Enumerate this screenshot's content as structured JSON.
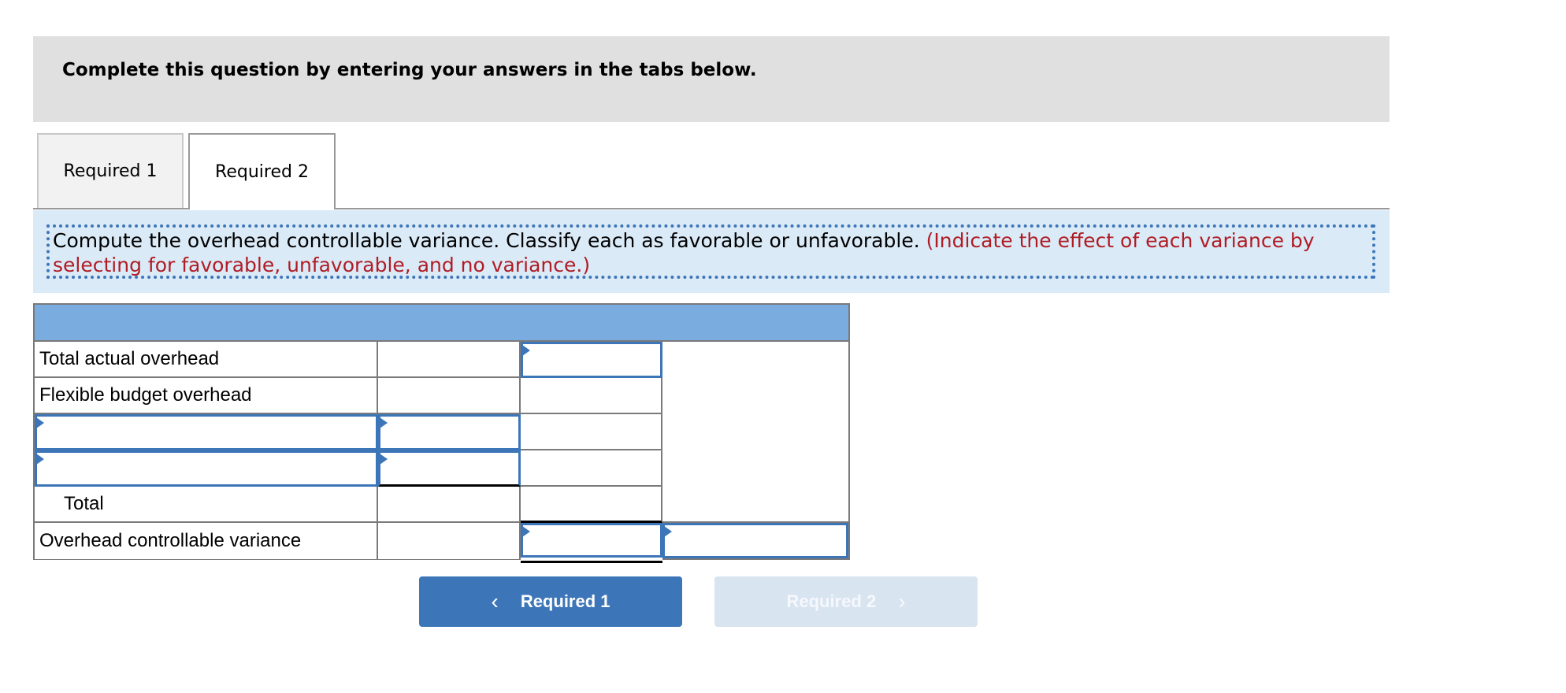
{
  "banner": {
    "text": "Complete this question by entering your answers in the tabs below."
  },
  "tabs": [
    {
      "label": "Required 1",
      "active": false
    },
    {
      "label": "Required 2",
      "active": true
    }
  ],
  "instruction": {
    "main": "Compute the overhead controllable variance. Classify each as favorable or unfavorable.",
    "note": "(Indicate the effect of each variance by selecting for favorable, unfavorable, and no variance.)"
  },
  "table": {
    "header": "",
    "rows": [
      {
        "label": "Total actual overhead",
        "col1": "",
        "col2": "",
        "col3": ""
      },
      {
        "label": "Flexible budget overhead",
        "col1": "",
        "col2": "",
        "col3": ""
      },
      {
        "label": "",
        "col1": "",
        "col2": "",
        "col3": ""
      },
      {
        "label": "",
        "col1": "",
        "col2": "",
        "col3": ""
      },
      {
        "label": "Total",
        "col1": "",
        "col2": "",
        "col3": ""
      },
      {
        "label": "Overhead controllable variance",
        "col1": "",
        "col2": "",
        "col3": ""
      }
    ]
  },
  "navigation": {
    "prev_label": "Required 1",
    "next_label": "Required 2",
    "prev_icon": "chevron-left-icon",
    "next_icon": "chevron-right-icon"
  },
  "colors": {
    "accent": "#3d76b8",
    "header_fill": "#7aace0",
    "instruction_bg": "#dbeaf7",
    "note_red": "#b01c24",
    "banner_bg": "#e0e0e0"
  }
}
